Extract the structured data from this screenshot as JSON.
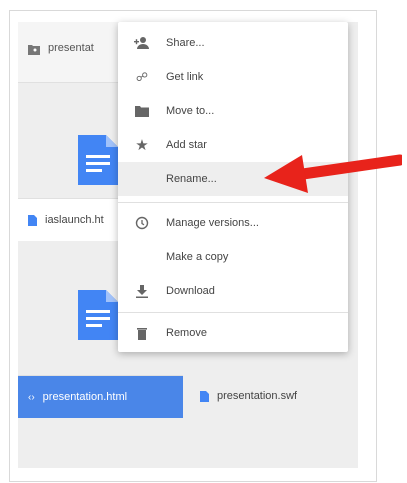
{
  "header_file": {
    "label": "presentat",
    "icon": "folder-shared-icon"
  },
  "menu": {
    "items": [
      {
        "id": "share",
        "label": "Share...",
        "icon": "person-add-icon"
      },
      {
        "id": "get-link",
        "label": "Get link",
        "icon": "link-icon"
      },
      {
        "id": "move-to",
        "label": "Move to...",
        "icon": "folder-icon"
      },
      {
        "id": "add-star",
        "label": "Add star",
        "icon": "star-icon"
      },
      {
        "id": "rename",
        "label": "Rename...",
        "icon": "",
        "highlighted": true
      },
      {
        "id": "manage-versions",
        "label": "Manage versions...",
        "icon": "history-icon"
      },
      {
        "id": "make-copy",
        "label": "Make a copy",
        "icon": ""
      },
      {
        "id": "download",
        "label": "Download",
        "icon": "download-icon"
      },
      {
        "id": "remove",
        "label": "Remove",
        "icon": "trash-icon"
      }
    ]
  },
  "files": [
    {
      "name": "iaslaunch.ht",
      "icon": "document-icon",
      "selected": false
    },
    {
      "name": "presentation.html",
      "icon": "code-icon",
      "selected": true
    },
    {
      "name": "presentation.swf",
      "icon": "document-icon",
      "selected": false
    }
  ],
  "colors": {
    "accent_blue": "#4a86e8",
    "doc_blue": "#4285f4",
    "arrow_red": "#e8231b"
  }
}
